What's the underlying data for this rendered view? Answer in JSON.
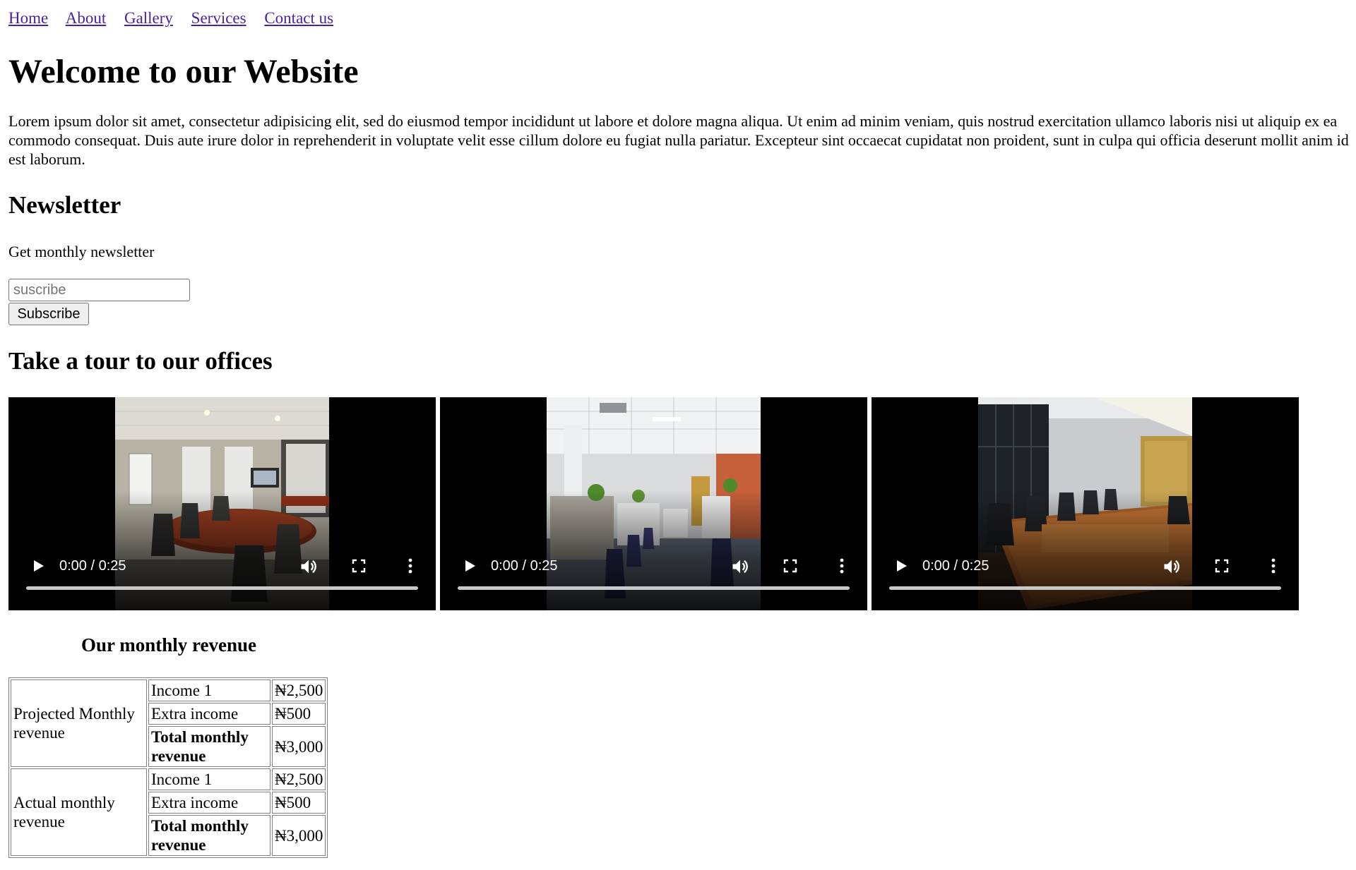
{
  "nav": {
    "items": [
      {
        "label": "Home"
      },
      {
        "label": "About"
      },
      {
        "label": "Gallery"
      },
      {
        "label": "Services"
      },
      {
        "label": "Contact us"
      }
    ],
    "link_color": "#4b1fa0"
  },
  "header": {
    "title": "Welcome to our Website",
    "intro": "Lorem ipsum dolor sit amet, consectetur adipisicing elit, sed do eiusmod tempor incididunt ut labore et dolore magna aliqua. Ut enim ad minim veniam, quis nostrud exercitation ullamco laboris nisi ut aliquip ex ea commodo consequat. Duis aute irure dolor in reprehenderit in voluptate velit esse cillum dolore eu fugiat nulla pariatur. Excepteur sint occaecat cupidatat non proident, sunt in culpa qui officia deserunt mollit anim id est laborum."
  },
  "newsletter": {
    "title": "Newsletter",
    "subtitle": "Get monthly newsletter",
    "input_placeholder": "suscribe",
    "input_value": "",
    "button_label": "Subscribe"
  },
  "tour": {
    "title": "Take a tour to our offices",
    "videos": [
      {
        "time": "0:00 / 0:25",
        "icons": [
          "play-icon",
          "volume-icon",
          "fullscreen-icon",
          "more-vert-icon"
        ]
      },
      {
        "time": "0:00 / 0:25",
        "icons": [
          "play-icon",
          "volume-icon",
          "fullscreen-icon",
          "more-vert-icon"
        ]
      },
      {
        "time": "0:00 / 0:25",
        "icons": [
          "play-icon",
          "volume-icon",
          "fullscreen-icon",
          "more-vert-icon"
        ]
      }
    ]
  },
  "revenue": {
    "caption": "Our monthly revenue",
    "groups": [
      {
        "label": "Projected Monthly revenue",
        "rows": [
          {
            "label": "Income 1",
            "amount": "₦2,500",
            "bold": false
          },
          {
            "label": "Extra income",
            "amount": "₦500",
            "bold": false
          },
          {
            "label": "Total monthly revenue",
            "amount": "₦3,000",
            "bold": true
          }
        ]
      },
      {
        "label": "Actual monthly revenue",
        "rows": [
          {
            "label": "Income 1",
            "amount": "₦2,500",
            "bold": false
          },
          {
            "label": "Extra income",
            "amount": "₦500",
            "bold": false
          },
          {
            "label": "Total monthly revenue",
            "amount": "₦3,000",
            "bold": true
          }
        ]
      }
    ]
  }
}
